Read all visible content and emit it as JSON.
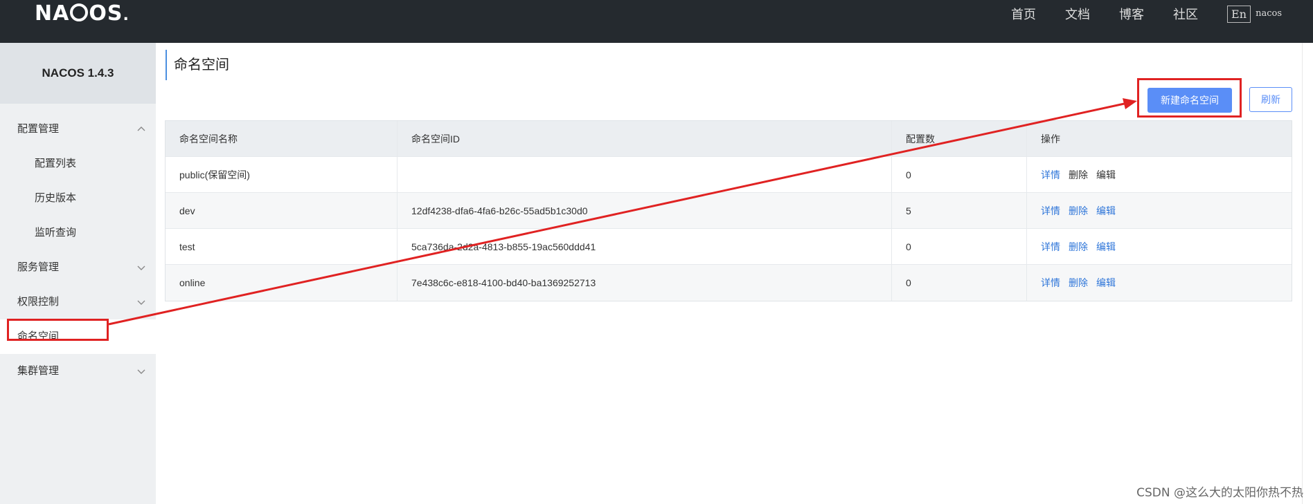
{
  "header": {
    "logo": "NACOS.",
    "nav": [
      "首页",
      "文档",
      "博客",
      "社区"
    ],
    "lang": "En",
    "user": "nacos"
  },
  "sidebar": {
    "version": "NACOS 1.4.3",
    "items": [
      {
        "label": "配置管理",
        "chevron": "up"
      },
      {
        "label": "配置列表",
        "sub": true
      },
      {
        "label": "历史版本",
        "sub": true
      },
      {
        "label": "监听查询",
        "sub": true
      },
      {
        "label": "服务管理",
        "chevron": "down"
      },
      {
        "label": "权限控制",
        "chevron": "down"
      },
      {
        "label": "命名空间",
        "active": true
      },
      {
        "label": "集群管理",
        "chevron": "down"
      }
    ]
  },
  "main": {
    "title": "命名空间",
    "create_button": "新建命名空间",
    "refresh_button": "刷新",
    "table": {
      "columns": [
        "命名空间名称",
        "命名空间ID",
        "配置数",
        "操作"
      ],
      "rows": [
        {
          "name": "public(保留空间)",
          "id": "",
          "count": "0"
        },
        {
          "name": "dev",
          "id": "12df4238-dfa6-4fa6-b26c-55ad5b1c30d0",
          "count": "5"
        },
        {
          "name": "test",
          "id": "5ca736da-2d2a-4813-b855-19ac560ddd41",
          "count": "0"
        },
        {
          "name": "online",
          "id": "7e438c6c-e818-4100-bd40-ba1369252713",
          "count": "0"
        }
      ],
      "actions": [
        "详情",
        "删除",
        "编辑"
      ]
    }
  },
  "watermark": "CSDN @这么大的太阳你热不热",
  "colors": {
    "accent": "#5a8ef7",
    "annotation": "#e02222",
    "header_bg": "#252a2f"
  }
}
